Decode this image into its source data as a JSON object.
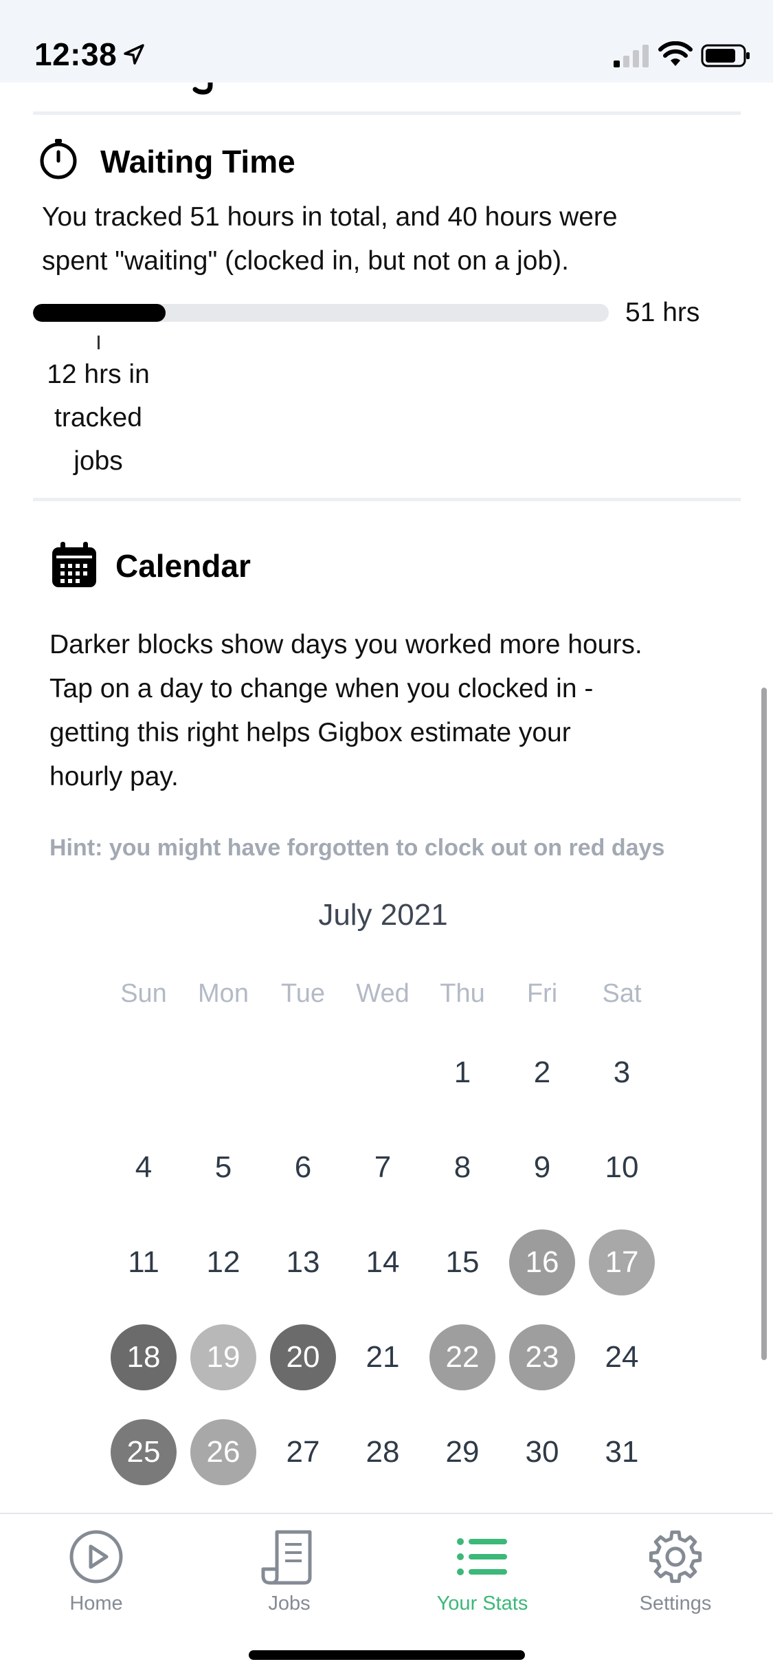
{
  "status_bar": {
    "time": "12:38",
    "icons": [
      "location-arrow-icon",
      "cellular-signal-icon",
      "wifi-icon",
      "battery-icon"
    ]
  },
  "waiting_time": {
    "icon": "stopwatch-icon",
    "title": "Waiting Time",
    "description_line1": "You tracked 51 hours in total, and 40 hours were",
    "description_line2": "spent \"waiting\" (clocked in, but not on a job).",
    "progress_fraction": 0.23,
    "total_label": "51 hrs",
    "tracked_caption_line1": "12 hrs in",
    "tracked_caption_line2": "tracked",
    "tracked_caption_line3": "jobs",
    "bar_color": "#000000",
    "track_color": "#e6e8ec"
  },
  "calendar": {
    "icon": "calendar-icon",
    "title": "Calendar",
    "description_line1": "Darker blocks show days you worked more hours.",
    "description_line2": "Tap on a day to change when you clocked in -",
    "description_line3": "getting this right helps Gigbox estimate your",
    "description_line4": "hourly pay.",
    "hint": "Hint: you might have forgotten to clock out on red days",
    "month": "July 2021",
    "weekdays": [
      "Sun",
      "Mon",
      "Tue",
      "Wed",
      "Thu",
      "Fri",
      "Sat"
    ],
    "first_weekday_index": 4,
    "days_in_month": 31,
    "day_shades": {
      "16": "#9c9c9c",
      "17": "#a8a8a8",
      "18": "#6b6b6b",
      "19": "#b8b8b8",
      "20": "#6b6b6b",
      "22": "#9e9e9e",
      "23": "#9e9e9e",
      "25": "#7a7a7a",
      "26": "#a8a8a8"
    }
  },
  "tab_bar": {
    "tabs": [
      {
        "label": "Home",
        "icon": "play-circle-icon",
        "active": false
      },
      {
        "label": "Jobs",
        "icon": "receipt-icon",
        "active": false
      },
      {
        "label": "Your Stats",
        "icon": "list-icon",
        "active": true
      },
      {
        "label": "Settings",
        "icon": "gear-icon",
        "active": false
      }
    ],
    "active_color": "#3cb878",
    "inactive_color": "#858b94"
  }
}
